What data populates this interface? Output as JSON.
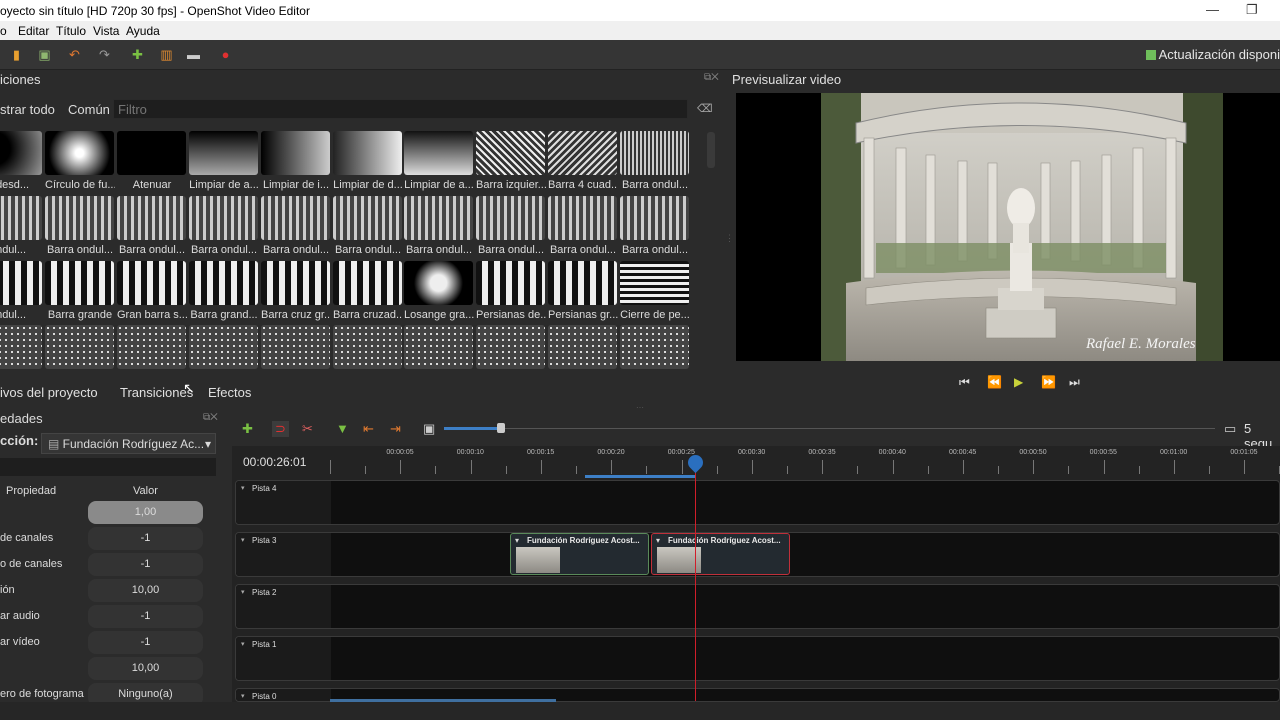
{
  "window": {
    "title": "oyecto sin título [HD 720p 30 fps] - OpenShot Video Editor"
  },
  "menu": [
    "o",
    "Editar",
    "Título",
    "Vista",
    "Ayuda"
  ],
  "toolbar": {
    "update_label": "Actualización disponi"
  },
  "transitions_panel": {
    "title": "iciones",
    "tabs": [
      "strar todo",
      "Común"
    ],
    "filter_placeholder": "Filtro",
    "items": [
      [
        "o desd...",
        "Círculo de fu...",
        "Atenuar",
        "Limpiar de a...",
        "Limpiar de i...",
        "Limpiar de d...",
        "Limpiar de a...",
        "Barra izquier...",
        "Barra 4 cuad...",
        "Barra ondul..."
      ],
      [
        "ondul...",
        "Barra ondul...",
        "Barra ondul...",
        "Barra ondul...",
        "Barra ondul...",
        "Barra ondul...",
        "Barra ondul...",
        "Barra ondul...",
        "Barra ondul...",
        "Barra ondul..."
      ],
      [
        "ondul...",
        "Barra grande",
        "Gran barra s...",
        "Barra grand...",
        "Barra cruz gr...",
        "Barra cruzad...",
        "Losange gra...",
        "Persianas de...",
        "Persianas gr...",
        "Cierre de pe..."
      ],
      [
        "",
        "",
        "",
        "",
        "",
        "",
        "",
        "",
        "",
        ""
      ]
    ]
  },
  "preview": {
    "title": "Previsualizar video",
    "watermark": "Rafael E. Morales"
  },
  "bottom_tabs": [
    "ivos del proyecto",
    "Transiciones",
    "Efectos"
  ],
  "properties": {
    "title": "edades",
    "selection_label": "cción:",
    "selection_value": "Fundación Rodríguez Ac...",
    "col_property": "Propiedad",
    "col_value": "Valor",
    "rows": [
      {
        "name": "",
        "value": "1,00"
      },
      {
        "name": "de canales",
        "value": "-1"
      },
      {
        "name": "o de canales",
        "value": "-1"
      },
      {
        "name": "ión",
        "value": "10,00"
      },
      {
        "name": "ar audio",
        "value": "-1"
      },
      {
        "name": "ar vídeo",
        "value": "-1"
      },
      {
        "name": "",
        "value": "10,00"
      },
      {
        "name": "ero de fotograma",
        "value": "Ninguno(a)"
      }
    ]
  },
  "timeline": {
    "zoom_label": "5 segu",
    "timecode": "00:00:26:01",
    "ruler_labels": [
      "00:00:05",
      "00:00:10",
      "00:00:15",
      "00:00:20",
      "00:00:25",
      "00:00:30",
      "00:00:35",
      "00:00:40",
      "00:00:45",
      "00:00:50",
      "00:00:55",
      "00:01:00",
      "00:01:05"
    ],
    "tracks": [
      "Pista 4",
      "Pista 3",
      "Pista 2",
      "Pista 1",
      "Pista 0"
    ],
    "clips": [
      "Fundación Rodríguez Acost...",
      "Fundación Rodríguez Acost..."
    ]
  },
  "colors": {
    "accent": "#2a6fbf",
    "playhead": "#d01e2a",
    "clip_border": "#5a8a5a",
    "clip_border_selected": "#c0303a"
  }
}
